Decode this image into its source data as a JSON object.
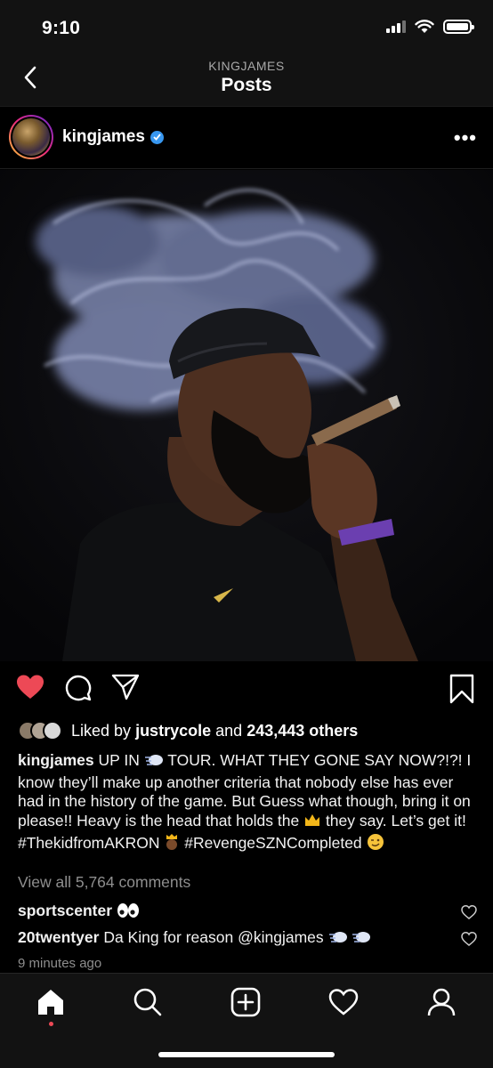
{
  "status_bar": {
    "time": "9:10"
  },
  "nav": {
    "subtitle": "KINGJAMES",
    "title": "Posts"
  },
  "post": {
    "username": "kingjames",
    "verified": true,
    "image_description": "man-smoking-cigar-photo",
    "liked": true
  },
  "likes": {
    "prefix": "Liked by",
    "user": "justrycole",
    "middle": "and",
    "others": "243,443 others"
  },
  "caption": {
    "username": "kingjames",
    "part1": "UP IN",
    "part2": "TOUR. WHAT THEY GONE SAY NOW?!?! I know they’ll make up another criteria that nobody else has ever had in the history of the game. But Guess what though, bring it on please!! Heavy is the head that holds the",
    "part3": "they say. Let’s get it!",
    "tag1": "#ThekidfromAKRON",
    "tag2": "#RevengeSZNCompleted"
  },
  "view_all": "View all 5,764 comments",
  "comments": [
    {
      "username": "sportscenter",
      "text": ""
    },
    {
      "username": "20twentyer",
      "text": "Da King for reason @kingjames"
    }
  ],
  "time_ago": "9 minutes ago",
  "colors": {
    "heart": "#ed4956",
    "verified": "#3897f0",
    "background": "#000000"
  }
}
